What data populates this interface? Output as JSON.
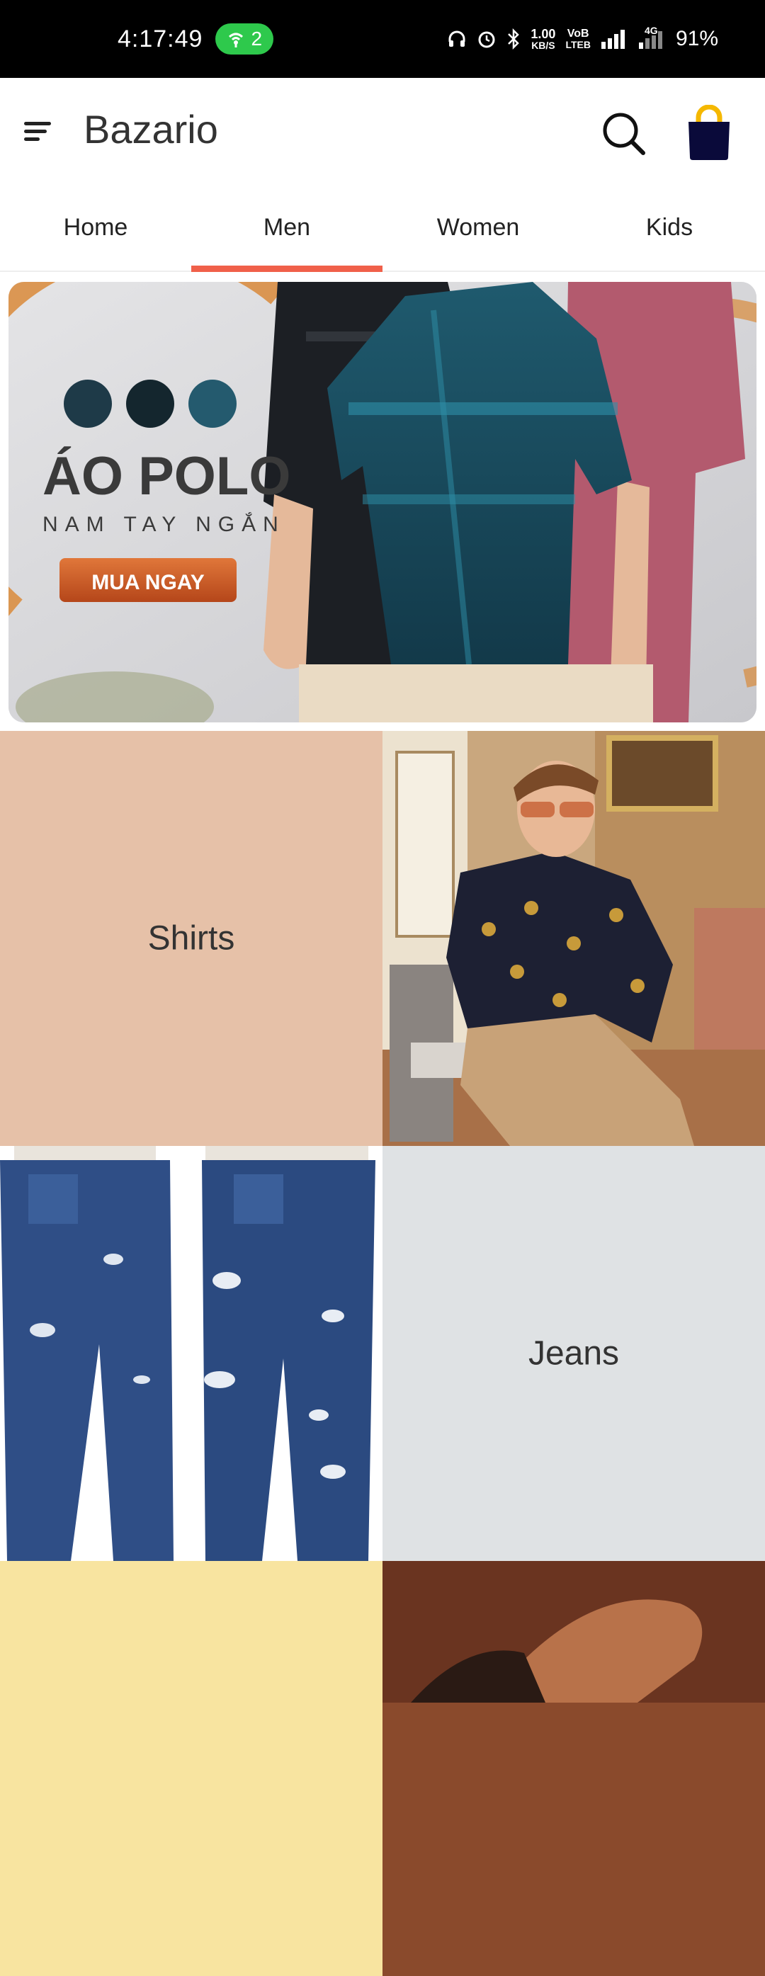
{
  "status_bar": {
    "time": "4:17:49",
    "hotspot_count": "2",
    "speed_top": "1.00",
    "speed_bottom": "KB/S",
    "volte_top": "VoB",
    "volte_bottom": "LTEB",
    "network_label": "4G",
    "battery": "91%"
  },
  "app_bar": {
    "title": "Bazario",
    "icons": [
      "menu-icon",
      "search-icon",
      "shopping-bag-icon"
    ],
    "bag_color": "#0a0a3a",
    "bag_handle_color": "#f5b800"
  },
  "tabs": {
    "items": [
      "Home",
      "Men",
      "Women",
      "Kids"
    ],
    "selected": "Men",
    "indicator_color": "#f0604a"
  },
  "banner": {
    "title": "ÁO POLO",
    "subtitle": "NAM TAY NGẮN",
    "cta": "MUA NGAY"
  },
  "categories": [
    {
      "label": "Shirts",
      "bg": "#e6c1a8"
    },
    {
      "label": "Jeans",
      "bg": "#dfe2e4"
    },
    {
      "label": "",
      "bg": "#f8e4a0"
    }
  ]
}
